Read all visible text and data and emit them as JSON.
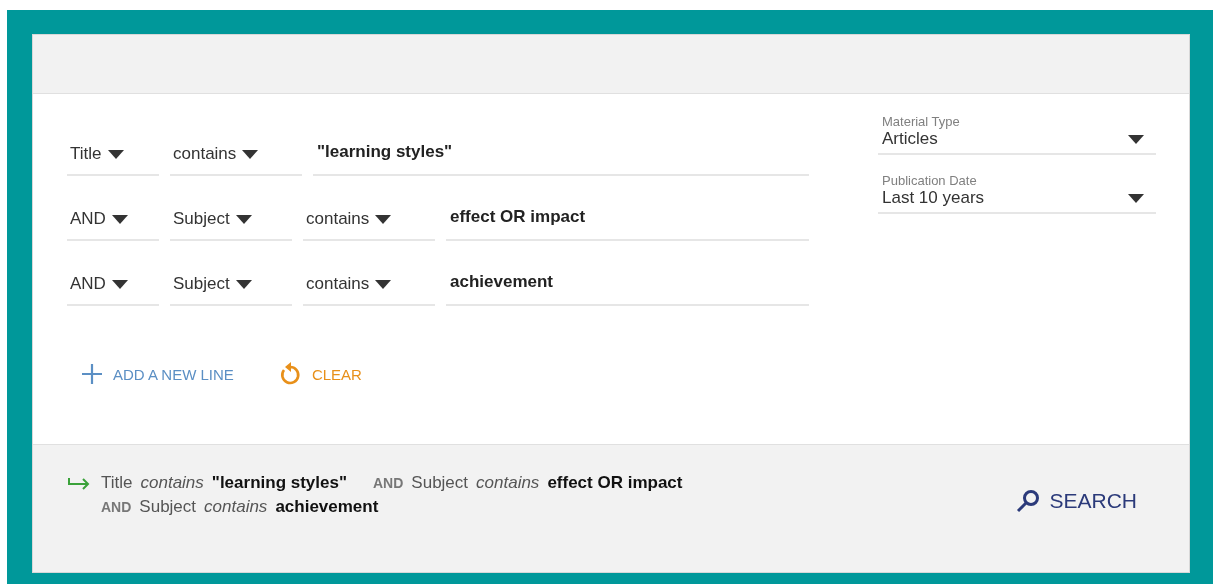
{
  "query_lines": [
    {
      "field": "Title",
      "operator": "contains",
      "value": "\"learning styles\""
    },
    {
      "boolean": "AND",
      "field": "Subject",
      "operator": "contains",
      "value": "effect OR impact"
    },
    {
      "boolean": "AND",
      "field": "Subject",
      "operator": "contains",
      "value": "achievement"
    }
  ],
  "filters": [
    {
      "label": "Material Type",
      "value": "Articles"
    },
    {
      "label": "Publication Date",
      "value": "Last 10 years"
    }
  ],
  "actions": [
    {
      "kind": "add",
      "label": "ADD A NEW LINE"
    },
    {
      "kind": "clear",
      "label": "CLEAR"
    }
  ],
  "summary": [
    {
      "field": "Title",
      "operator": "contains",
      "value": "\"learning styles\""
    },
    {
      "boolean": "AND",
      "field": "Subject",
      "operator": "contains",
      "value": "effect OR impact"
    },
    {
      "boolean": "AND",
      "field": "Subject",
      "operator": "contains",
      "value": "achievement"
    }
  ],
  "search_button": "SEARCH"
}
